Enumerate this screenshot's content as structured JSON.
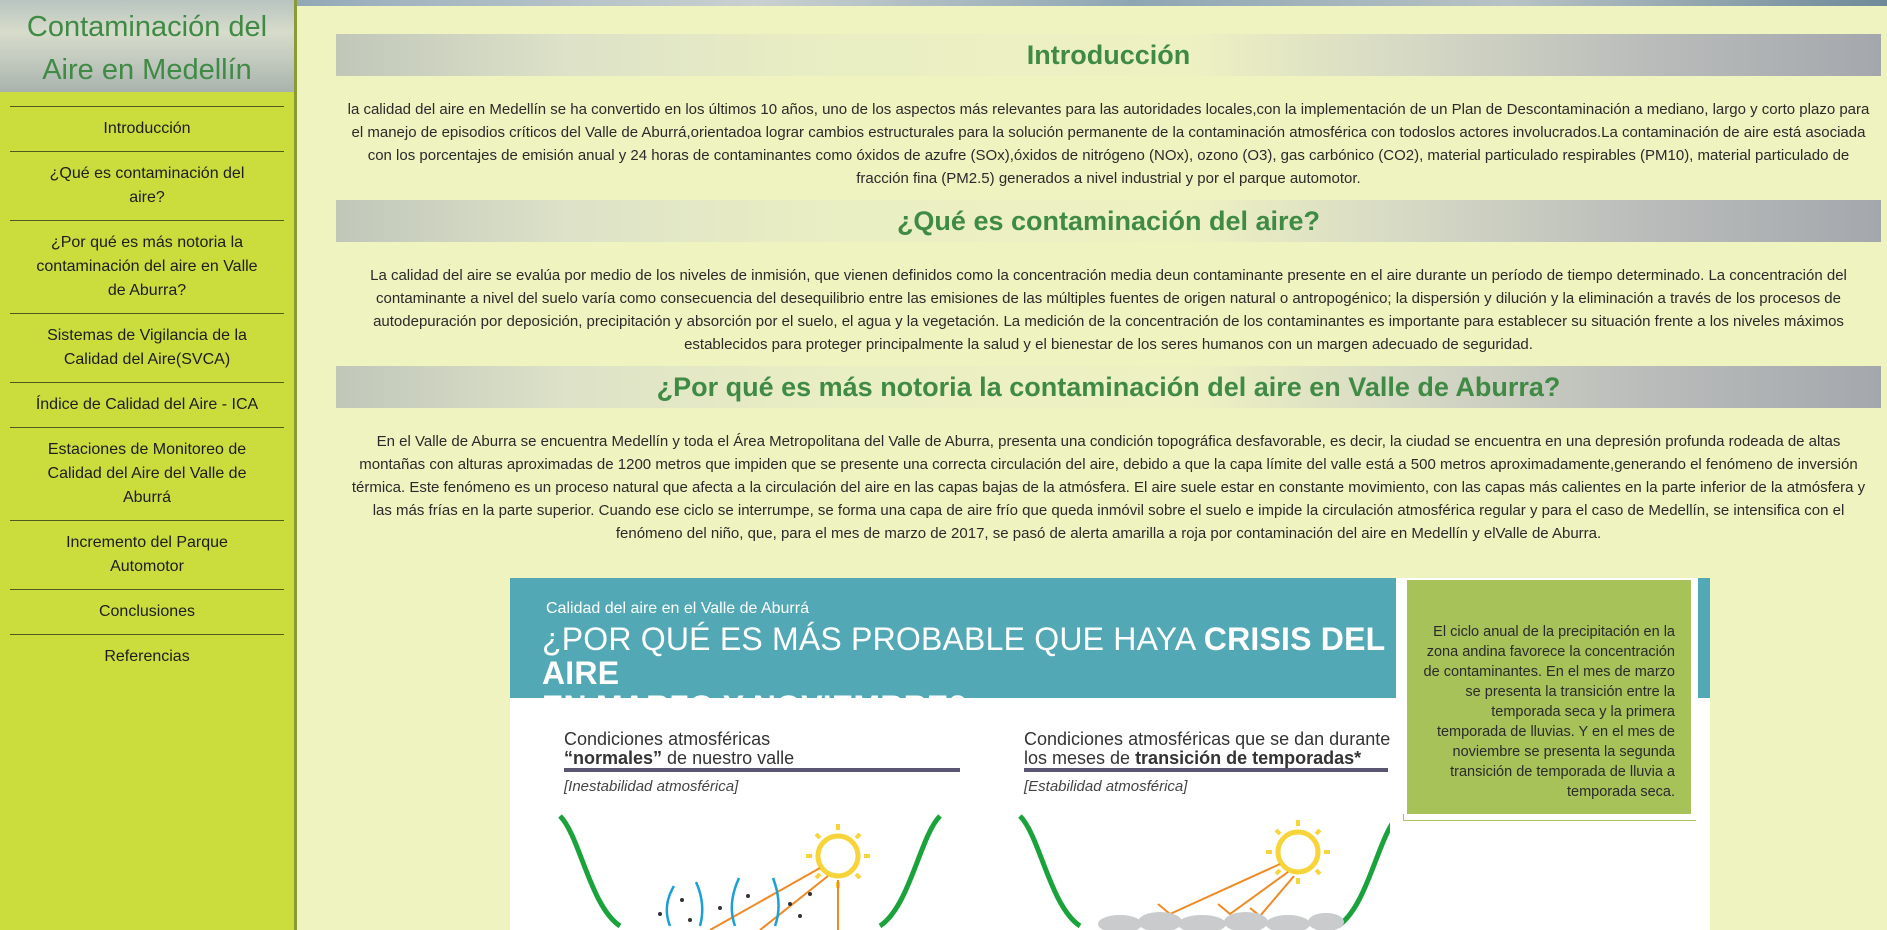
{
  "site": {
    "title_line1": "Contaminación del",
    "title_line2": "Aire en Medellín"
  },
  "nav": [
    {
      "label": "Introducción"
    },
    {
      "label": "¿Qué es contaminación del aire?"
    },
    {
      "label": "¿Por qué es más notoria la contaminación del aire en Valle de Aburra?"
    },
    {
      "label": "Sistemas de Vigilancia de la Calidad del Aire(SVCA)"
    },
    {
      "label": "Índice de Calidad del Aire - ICA"
    },
    {
      "label": "Estaciones de Monitoreo de Calidad del Aire del Valle de Aburrá"
    },
    {
      "label": "Incremento del Parque Automotor"
    },
    {
      "label": "Conclusiones"
    },
    {
      "label": "Referencias"
    }
  ],
  "sections": [
    {
      "title": "Introducción",
      "text": "la calidad del aire en Medellín se ha convertido en los últimos 10 años, uno de los aspectos más relevantes para las autoridades locales,con la implementación de un Plan de Descontaminación a mediano, largo y corto plazo para el manejo de episodios críticos del Valle de Aburrá,orientadoa lograr cambios estructurales para la solución permanente de la contaminación atmosférica con todoslos actores involucrados.La contaminación de aire está asociada con los porcentajes de emisión anual y 24 horas de contaminantes como óxidos de azufre (SOx),óxidos de nitrógeno (NOx), ozono (O3), gas carbónico (CO2), material particulado respirables (PM10), material particulado de fracción fina (PM2.5) generados a nivel industrial y por el parque automotor."
    },
    {
      "title": "¿Qué es contaminación del aire?",
      "text": "La calidad del aire se evalúa por medio de los niveles de inmisión, que vienen definidos como la concentración media deun contaminante presente en el aire durante un período de tiempo determinado. La concentración del contaminante a nivel del suelo varía como consecuencia del desequilibrio entre las emisiones de las múltiples fuentes de origen natural o antropogénico; la dispersión y dilución y la eliminación a través de los procesos de autodepuración por deposición, precipitación y absorción por el suelo, el agua y la vegetación. La medición de la concentración de los contaminantes es importante para establecer su situación frente a los niveles máximos establecidos para proteger principalmente la salud y el bienestar de los seres humanos con un margen adecuado de seguridad."
    },
    {
      "title": "¿Por qué es más notoria la contaminación del aire en Valle de Aburra?",
      "text": "En el Valle de Aburra se encuentra Medellín y toda el Área Metropolitana del Valle de Aburra, presenta una condición topográfica desfavorable, es decir, la ciudad se encuentra en una depresión profunda rodeada de altas montañas con alturas aproximadas de 1200 metros que impiden que se presente una correcta circulación del aire, debido a que la capa límite del valle está a 500 metros aproximadamente,generando el fenómeno de inversión térmica. Este fenómeno es un proceso natural que afecta a la circulación del aire en las capas bajas de la atmósfera. El aire suele estar en constante movimiento, con las capas más calientes en la parte inferior de la atmósfera y las más frías en la parte superior. Cuando ese ciclo se interrumpe, se forma una capa de aire frío que queda inmóvil sobre el suelo e impide la circulación atmosférica regular y para el caso de Medellín, se intensifica con el fenómeno del niño, que, para el mes de marzo de 2017, se pasó de alerta amarilla a roja por contaminación del aire en Medellín y elValle de Aburra."
    }
  ],
  "infographic": {
    "kicker": "Calidad del aire en el Valle de Aburrá",
    "headline_a": "¿POR QUÉ ES MÁS PROBABLE QUE HAYA ",
    "headline_b": "CRISIS DEL AIRE",
    "headline_c": "EN MARZO Y NOVIEMBRE",
    "headline_d": "?",
    "side_note": "El ciclo anual de la precipitación en la zona andina favorece la concentración de contaminantes. En el mes de marzo se presenta la transición entre la temporada seca y la primera temporada de lluvias. Y en el mes de noviembre se presenta la segunda transición de temporada de lluvia a temporada seca.",
    "left_title_a": "Condiciones atmosféricas",
    "left_title_b": "“normales”",
    "left_title_c": " de nuestro valle",
    "left_sub": "[Inestabilidad atmosférica]",
    "right_title_a": "Condiciones atmosféricas que se dan durante",
    "right_title_b": "los meses de ",
    "right_title_c": "transición de temporadas*",
    "right_sub": "[Estabilidad atmosférica]",
    "colors": {
      "banner": "#52a9b5",
      "side": "#a8c25a",
      "valley": "#1aa33a",
      "sun": "#f6d43a",
      "ray": "#f08a24"
    }
  }
}
